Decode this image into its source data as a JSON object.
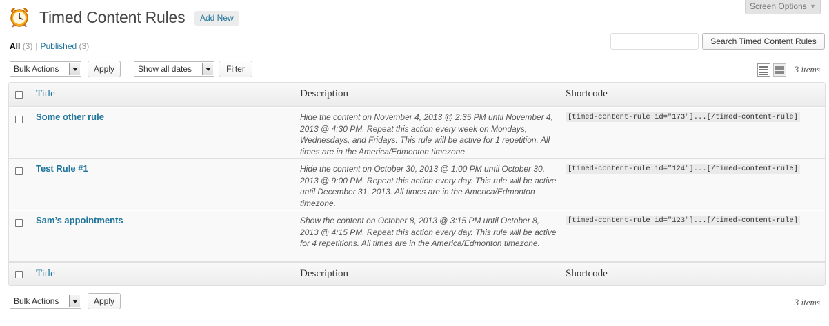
{
  "screen_options": {
    "label": "Screen Options"
  },
  "header": {
    "title": "Timed Content Rules",
    "add_new": "Add New"
  },
  "views": {
    "all": {
      "label": "All",
      "count": "(3)"
    },
    "separator": "|",
    "published": {
      "label": "Published",
      "count": "(3)"
    }
  },
  "search": {
    "value": "",
    "button": "Search Timed Content Rules"
  },
  "tablenav_top": {
    "bulk_actions": "Bulk Actions",
    "apply": "Apply",
    "date_filter": "Show all dates",
    "filter": "Filter",
    "items_count": "3 items"
  },
  "tablenav_bottom": {
    "bulk_actions": "Bulk Actions",
    "apply": "Apply",
    "items_count": "3 items"
  },
  "table": {
    "columns": [
      "Title",
      "Description",
      "Shortcode"
    ],
    "rows": [
      {
        "title": "Some other rule",
        "description": "Hide the content on November 4, 2013 @ 2:35 PM until November 4, 2013 @ 4:30 PM. Repeat this action every week on Mondays, Wednesdays, and Fridays. This rule will be active for 1 repetition. All times are in the America/Edmonton timezone.",
        "shortcode": "[timed-content-rule id=\"173\"]...[/timed-content-rule]"
      },
      {
        "title": "Test Rule #1",
        "description": "Hide the content on October 30, 2013 @ 1:00 PM until October 30, 2013 @ 9:00 PM. Repeat this action every day. This rule will be active until December 31, 2013. All times are in the America/Edmonton timezone.",
        "shortcode": "[timed-content-rule id=\"124\"]...[/timed-content-rule]"
      },
      {
        "title": "Sam’s appointments",
        "description": "Show the content on October 8, 2013 @ 3:15 PM until October 8, 2013 @ 4:15 PM. Repeat this action every day. This rule will be active for 4 repetitions. All times are in the America/Edmonton timezone.",
        "shortcode": "[timed-content-rule id=\"123\"]...[/timed-content-rule]"
      }
    ]
  },
  "icons": {
    "page_icon": "alarm-clock-icon",
    "view_list": "list-view-icon",
    "view_excerpt": "excerpt-view-icon"
  },
  "colors": {
    "link": "#21759b",
    "header_bg": "#ececec",
    "row_bg": "#f9f9f9"
  }
}
